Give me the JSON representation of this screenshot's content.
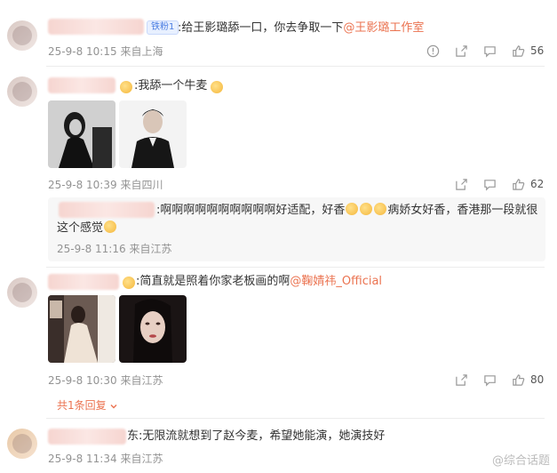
{
  "comments": [
    {
      "badge": "铁粉1",
      "text_prefix": ":给王影璐舔一口，你去争取一下",
      "mention": "@王影璐工作室",
      "timestamp": "25-9-8 10:15",
      "location": "来自上海",
      "likes": "56"
    },
    {
      "text": ":我舔一个牛麦",
      "timestamp": "25-9-8 10:39",
      "location": "来自四川",
      "likes": "62",
      "reply": {
        "text_line1": ":啊啊啊啊啊啊啊啊啊啊好适配，好香",
        "text_line1b": "病娇女好香，香港那一段就很",
        "text_line2": "这个感觉",
        "timestamp": "25-9-8 11:16",
        "location": "来自江苏"
      }
    },
    {
      "text_prefix": ":简直就是照着你家老板画的啊",
      "mention": "@鞠婧祎_Official",
      "timestamp": "25-9-8 10:30",
      "location": "来自江苏",
      "likes": "80",
      "replies_link": "共1条回复"
    },
    {
      "text": "东:无限流就想到了赵今麦，希望她能演，她演技好",
      "timestamp": "25-9-8 11:34",
      "location": "来自江苏"
    }
  ],
  "watermark": "@综合话题",
  "icons": [
    "report-icon",
    "share-icon",
    "comment-icon",
    "like-icon"
  ]
}
